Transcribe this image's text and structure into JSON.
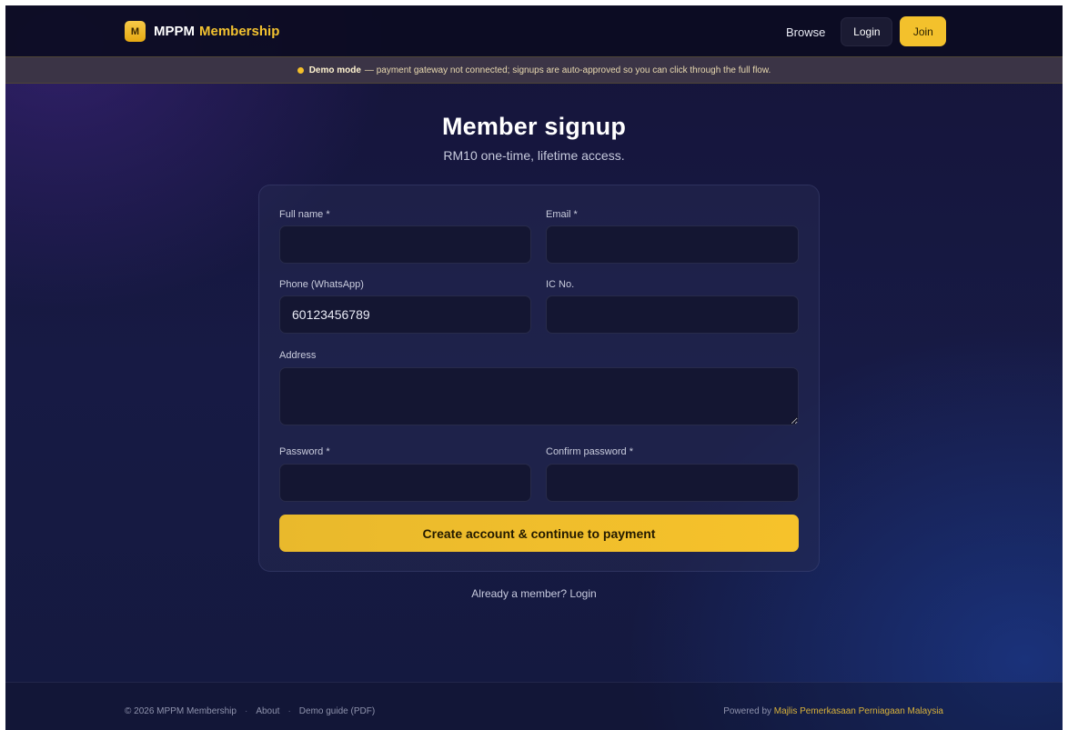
{
  "nav": {
    "logo_letter": "M",
    "brand_primary": "MPPM",
    "brand_accent": "Membership",
    "browse": "Browse",
    "login": "Login",
    "join": "Join"
  },
  "banner": {
    "strong": "Demo mode",
    "text": "— payment gateway not connected; signups are auto-approved so you can click through the full flow."
  },
  "page": {
    "title": "Member signup",
    "subtitle": "RM10 one-time, lifetime access."
  },
  "form": {
    "full_name": {
      "label": "Full name *",
      "value": ""
    },
    "email": {
      "label": "Email *",
      "value": ""
    },
    "phone": {
      "label": "Phone (WhatsApp)",
      "value": "60123456789"
    },
    "ic": {
      "label": "IC No.",
      "value": ""
    },
    "address": {
      "label": "Address",
      "value": ""
    },
    "password": {
      "label": "Password *",
      "value": ""
    },
    "confirm_password": {
      "label": "Confirm password *",
      "value": ""
    },
    "submit": "Create account & continue to payment"
  },
  "already_member": "Already a member? Login",
  "footer": {
    "copyright": "© 2026 MPPM Membership",
    "about": "About",
    "demo_guide": "Demo guide (PDF)",
    "powered_by": "Powered by",
    "org": "Majlis Pemerkasaan Perniagaan Malaysia"
  },
  "colors": {
    "accent": "#f3c12c",
    "background": "#171a44",
    "banner": "#3b3446"
  }
}
